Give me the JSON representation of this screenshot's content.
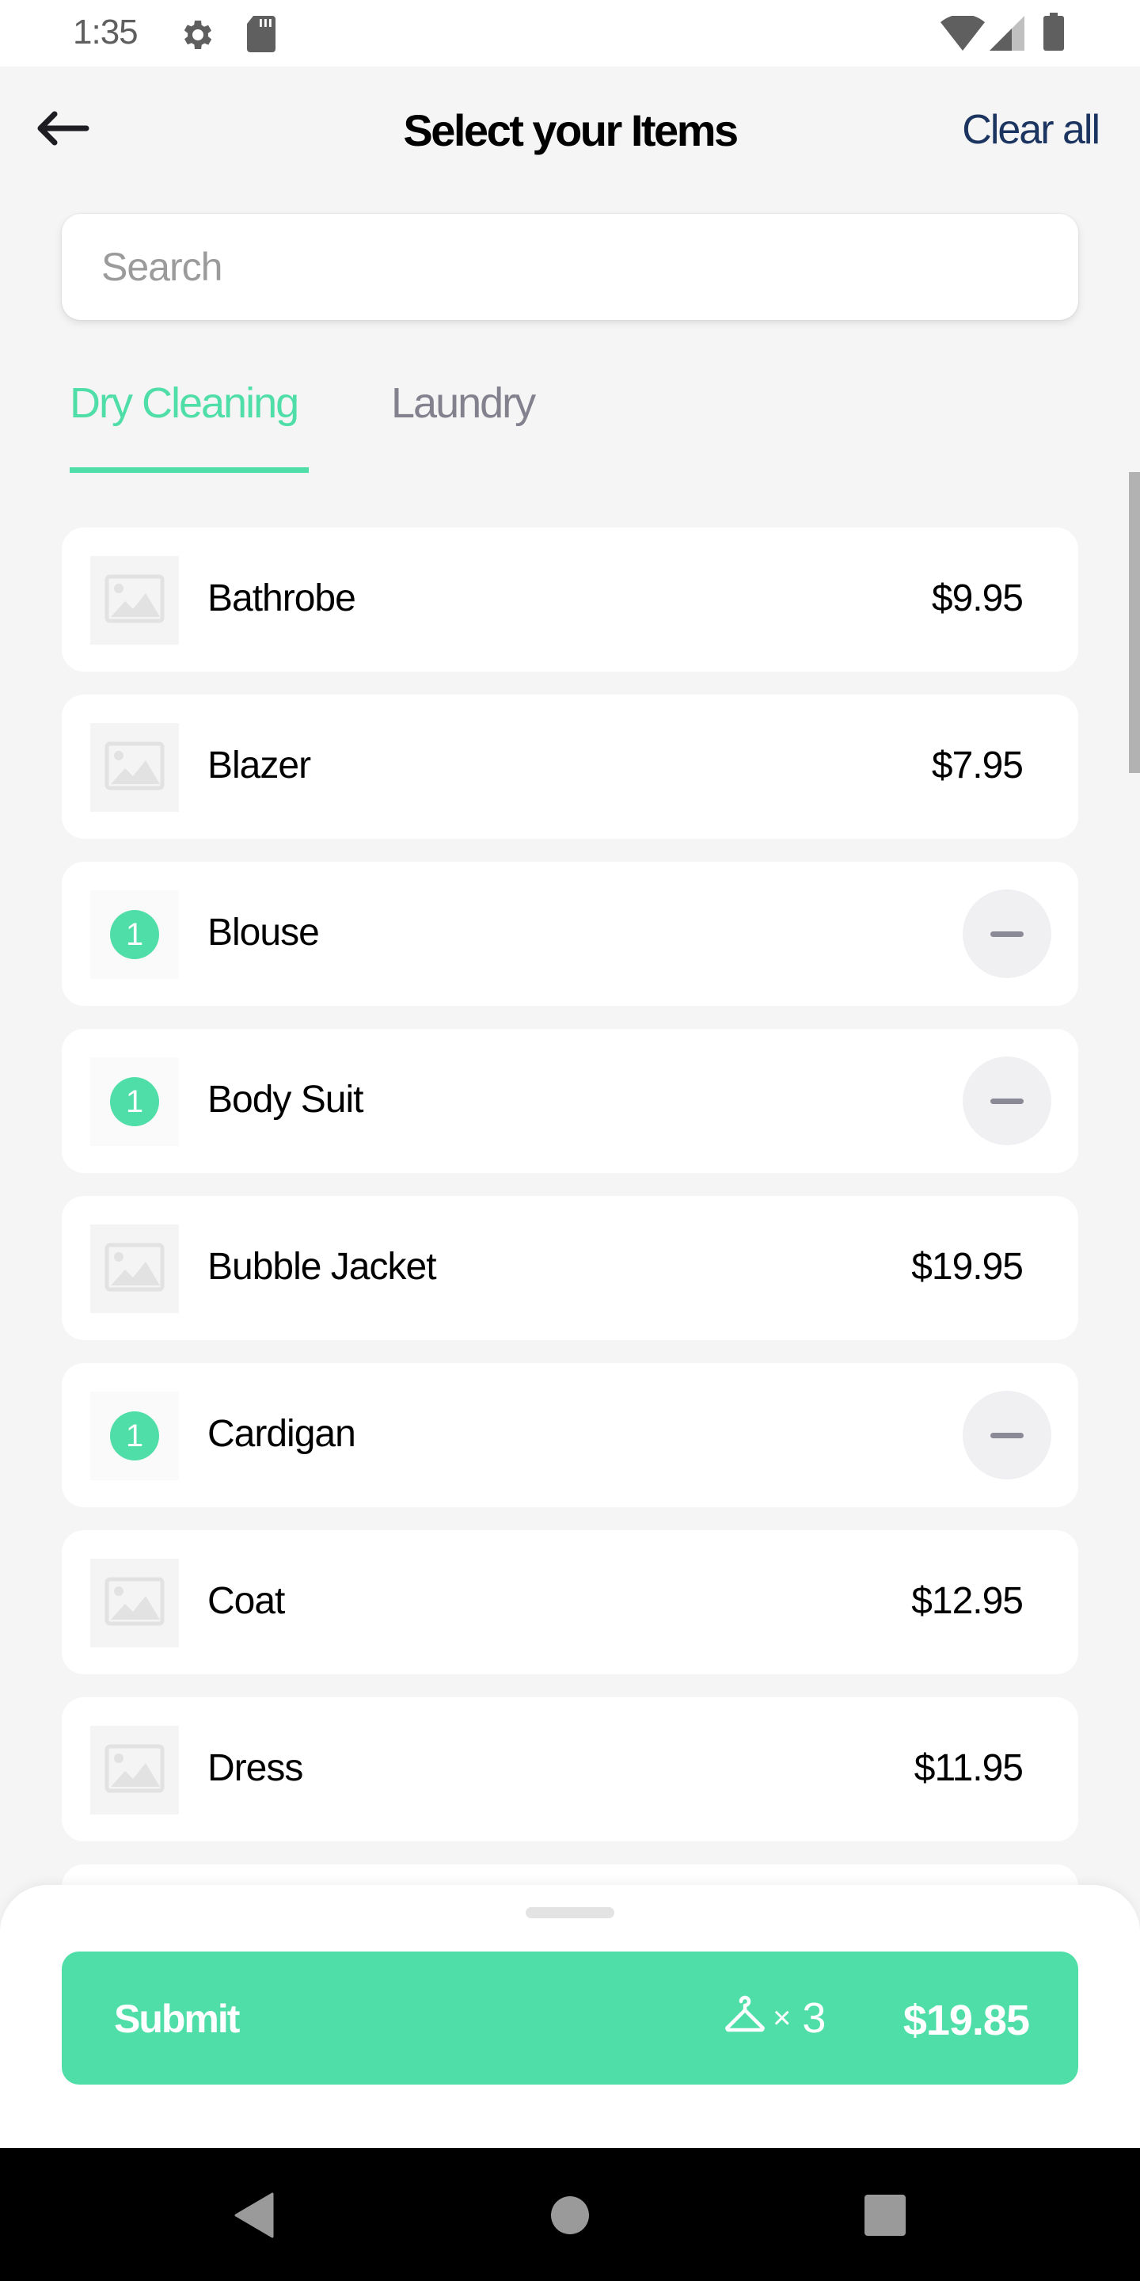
{
  "status_bar": {
    "time": "1:35",
    "left_icons": [
      "gear-icon",
      "sd-card-icon"
    ],
    "right_icons": [
      "wifi-icon",
      "cellular-signal-icon",
      "battery-icon"
    ]
  },
  "header": {
    "back_icon": "arrow-left-icon",
    "title": "Select your Items",
    "clear_all_label": "Clear all",
    "clear_all_color": "#1c3560"
  },
  "search": {
    "placeholder": "Search",
    "value": ""
  },
  "tabs": [
    {
      "label": "Dry Cleaning",
      "active": true
    },
    {
      "label": "Laundry",
      "active": false
    }
  ],
  "colors": {
    "accent": "#50dea8",
    "background": "#f5f5f5",
    "inactive_tab": "#82818d"
  },
  "items": [
    {
      "name": "Bathrobe",
      "price": "$9.95",
      "quantity": 0
    },
    {
      "name": "Blazer",
      "price": "$7.95",
      "quantity": 0
    },
    {
      "name": "Blouse",
      "quantity": 1,
      "quantity_label": "1"
    },
    {
      "name": "Body Suit",
      "quantity": 1,
      "quantity_label": "1"
    },
    {
      "name": "Bubble Jacket",
      "price": "$19.95",
      "quantity": 0
    },
    {
      "name": "Cardigan",
      "quantity": 1,
      "quantity_label": "1"
    },
    {
      "name": "Coat",
      "price": "$12.95",
      "quantity": 0
    },
    {
      "name": "Dress",
      "price": "$11.95",
      "quantity": 0
    }
  ],
  "footer": {
    "submit_label": "Submit",
    "item_icon": "hanger-icon",
    "times_symbol": "×",
    "item_count": "3",
    "total": "$19.85"
  },
  "nav_bar": {
    "buttons": [
      "back-triangle-icon",
      "home-circle-icon",
      "recents-square-icon"
    ]
  }
}
